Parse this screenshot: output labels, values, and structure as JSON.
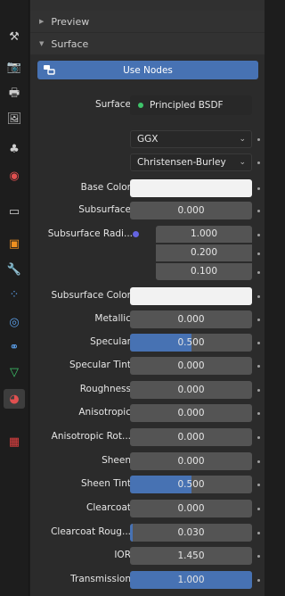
{
  "tabs": [
    {
      "name": "tool-tab-icon",
      "glyph": "⚒"
    },
    {
      "name": "render-tab-icon",
      "glyph": "📷"
    },
    {
      "name": "output-tab-icon",
      "glyph": "🖶"
    },
    {
      "name": "view-layer-tab-icon",
      "glyph": "🖼"
    },
    {
      "name": "scene-tab-icon",
      "glyph": "♣"
    },
    {
      "name": "world-tab-icon",
      "glyph": "◉"
    },
    {
      "name": "collection-tab-icon",
      "glyph": "▭"
    },
    {
      "name": "object-tab-icon",
      "glyph": "▣"
    },
    {
      "name": "modifier-tab-icon",
      "glyph": "🔧"
    },
    {
      "name": "particles-tab-icon",
      "glyph": "⁘"
    },
    {
      "name": "physics-tab-icon",
      "glyph": "◎"
    },
    {
      "name": "constraints-tab-icon",
      "glyph": "⚭"
    },
    {
      "name": "data-tab-icon",
      "glyph": "▽"
    },
    {
      "name": "material-tab-icon",
      "glyph": "◕"
    },
    {
      "name": "texture-tab-icon",
      "glyph": "▦"
    }
  ],
  "panel": {
    "preview_label": "Preview",
    "surface_label": "Surface",
    "use_nodes_label": "Use Nodes",
    "surface_row_label": "Surface",
    "shader_name": "Principled BSDF",
    "distribution": "GGX",
    "subsurface_method": "Christensen-Burley"
  },
  "props": {
    "base_color": {
      "label": "Base Color",
      "color": "#f2f2f2"
    },
    "subsurface": {
      "label": "Subsurface",
      "value": "0.000",
      "fraction": 0
    },
    "subsurface_radius": {
      "label": "Subsurface Radi...",
      "values": [
        "1.000",
        "0.200",
        "0.100"
      ]
    },
    "subsurface_color": {
      "label": "Subsurface Color",
      "color": "#f2f2f2"
    },
    "metallic": {
      "label": "Metallic",
      "value": "0.000",
      "fraction": 0
    },
    "specular": {
      "label": "Specular",
      "value": "0.500",
      "fraction": 0.5
    },
    "specular_tint": {
      "label": "Specular Tint",
      "value": "0.000",
      "fraction": 0
    },
    "roughness": {
      "label": "Roughness",
      "value": "0.000",
      "fraction": 0
    },
    "anisotropic": {
      "label": "Anisotropic",
      "value": "0.000",
      "fraction": 0
    },
    "anisotropic_rot": {
      "label": "Anisotropic Rot...",
      "value": "0.000",
      "fraction": 0
    },
    "sheen": {
      "label": "Sheen",
      "value": "0.000",
      "fraction": 0
    },
    "sheen_tint": {
      "label": "Sheen Tint",
      "value": "0.500",
      "fraction": 0.5
    },
    "clearcoat": {
      "label": "Clearcoat",
      "value": "0.000",
      "fraction": 0
    },
    "clearcoat_rough": {
      "label": "Clearcoat Roug...",
      "value": "0.030",
      "fraction": 0.03
    },
    "ior": {
      "label": "IOR",
      "value": "1.450",
      "fraction": 0
    },
    "transmission": {
      "label": "Transmission",
      "value": "1.000",
      "fraction": 1
    }
  },
  "colors": {
    "accent": "#4772b3",
    "panel": "#2b2b2b",
    "field": "#545454",
    "socket_gray": "#c9c9c9",
    "socket_yellow": "#e8d24a",
    "socket_blue": "#6464e0",
    "shader_green": "#3ec46a"
  }
}
